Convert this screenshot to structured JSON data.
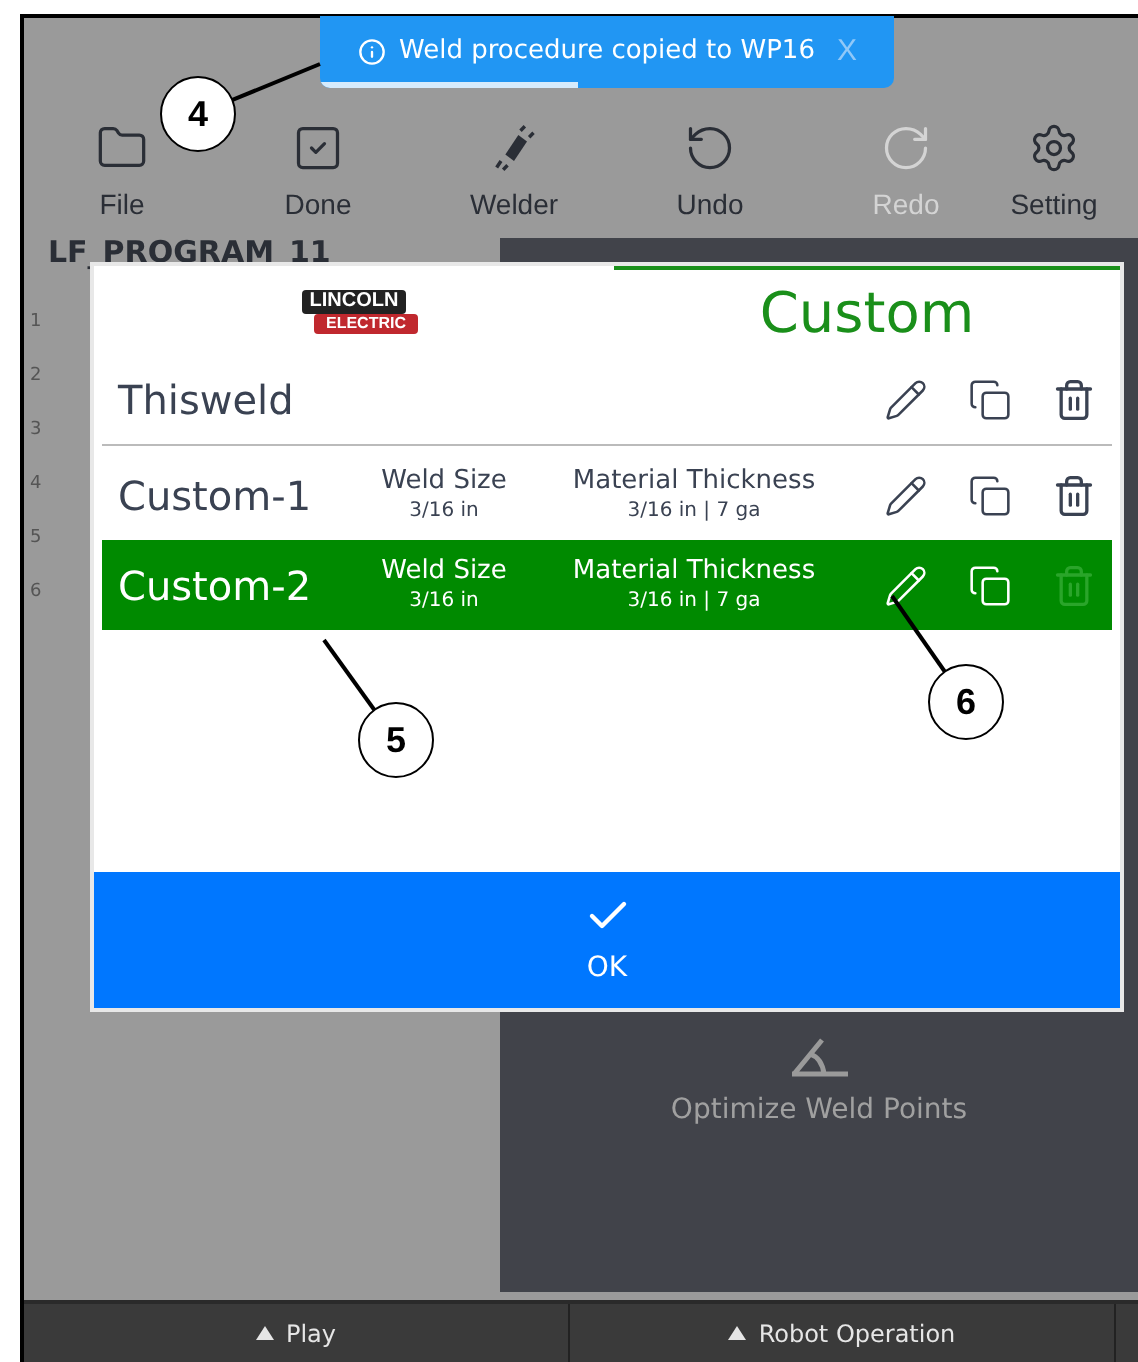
{
  "toast": {
    "message": "Weld procedure copied to WP16",
    "close": "X",
    "level": 0.45
  },
  "toolbar": [
    {
      "kind": "folder",
      "label": "File",
      "disabled": false
    },
    {
      "kind": "done",
      "label": "Done",
      "disabled": false
    },
    {
      "kind": "welder",
      "label": "Welder",
      "disabled": false
    },
    {
      "kind": "undo",
      "label": "Undo",
      "disabled": false
    },
    {
      "kind": "redo",
      "label": "Redo",
      "disabled": true
    },
    {
      "kind": "settings",
      "label": "Setting",
      "disabled": false
    }
  ],
  "program": {
    "title": "LF_PROGRAM_11",
    "line_numbers": [
      "1",
      "2",
      "3",
      "4",
      "5",
      "6"
    ]
  },
  "dialog": {
    "brand_top": "LINCOLN",
    "brand_bottom": "ELECTRIC",
    "title": "Custom",
    "rows": [
      {
        "name": "Thisweld",
        "selected": false,
        "delete_disabled": false
      },
      {
        "name": "Custom-1",
        "weld_size_label": "Weld Size",
        "weld_size": "3/16 in",
        "thickness_label": "Material Thickness",
        "thickness": "3/16 in | 7 ga",
        "selected": false,
        "delete_disabled": false
      },
      {
        "name": "Custom-2",
        "weld_size_label": "Weld Size",
        "weld_size": "3/16 in",
        "thickness_label": "Material Thickness",
        "thickness": "3/16 in | 7 ga",
        "selected": true,
        "delete_disabled": true
      }
    ],
    "ok": "OK"
  },
  "right_panel": {
    "action": "Optimize Weld Points"
  },
  "bottom_bar": [
    "Play",
    "Robot Operation"
  ],
  "callouts": [
    "4",
    "5",
    "6"
  ]
}
